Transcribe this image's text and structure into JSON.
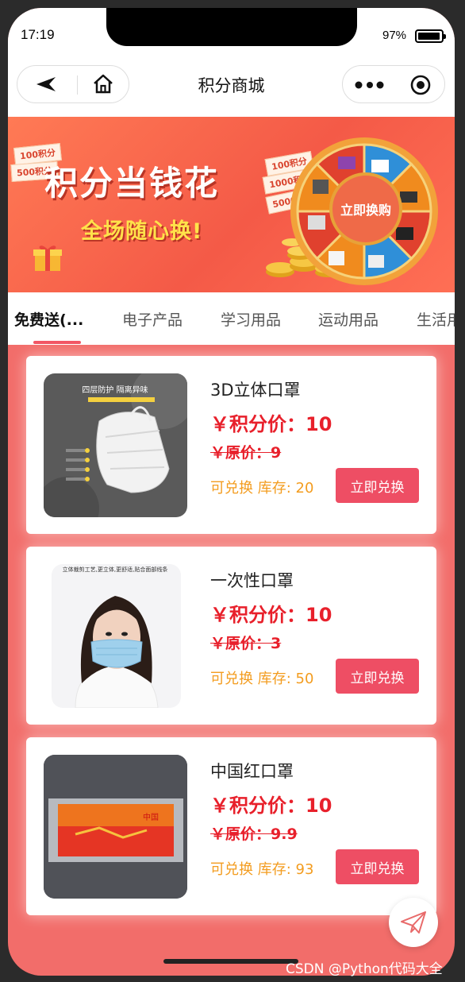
{
  "status_bar": {
    "time": "17:19",
    "battery": "97%",
    "battery_level": 0.97
  },
  "nav": {
    "title": "积分商城"
  },
  "banner": {
    "tags": [
      "100积分",
      "500积分"
    ],
    "tags_right": [
      "100积分",
      "1000积分",
      "5000积分"
    ],
    "title": "积分当钱花",
    "subtitle": "全场随心换!",
    "wheel_center": "立即换购"
  },
  "tabs": [
    {
      "label": "免费送(...",
      "active": true
    },
    {
      "label": "电子产品",
      "active": false
    },
    {
      "label": "学习用品",
      "active": false
    },
    {
      "label": "运动用品",
      "active": false
    },
    {
      "label": "生活用",
      "active": false
    }
  ],
  "products": [
    {
      "name": "3D立体口罩",
      "price": "￥积分价：10",
      "original": "￥原价：9",
      "stock": "可兑换 库存: 20",
      "button": "立即兑换",
      "image_caption": "四层防护 隔离异味"
    },
    {
      "name": "一次性口罩",
      "price": "￥积分价：10",
      "original": "￥原价：3",
      "stock": "可兑换 库存: 50",
      "button": "立即兑换",
      "image_caption": "立体裁剪工艺,更立体,更舒适,贴合面部线条"
    },
    {
      "name": "中国红口罩",
      "price": "￥积分价：10",
      "original": "￥原价：9.9",
      "stock": "可兑换 库存: 93",
      "button": "立即兑换",
      "image_caption": ""
    }
  ],
  "watermark": "CSDN @Python代码大全",
  "colors": {
    "accent": "#ee4e64",
    "price": "#e8202b",
    "stock": "#f39c1f",
    "background": "#f26d6a"
  }
}
